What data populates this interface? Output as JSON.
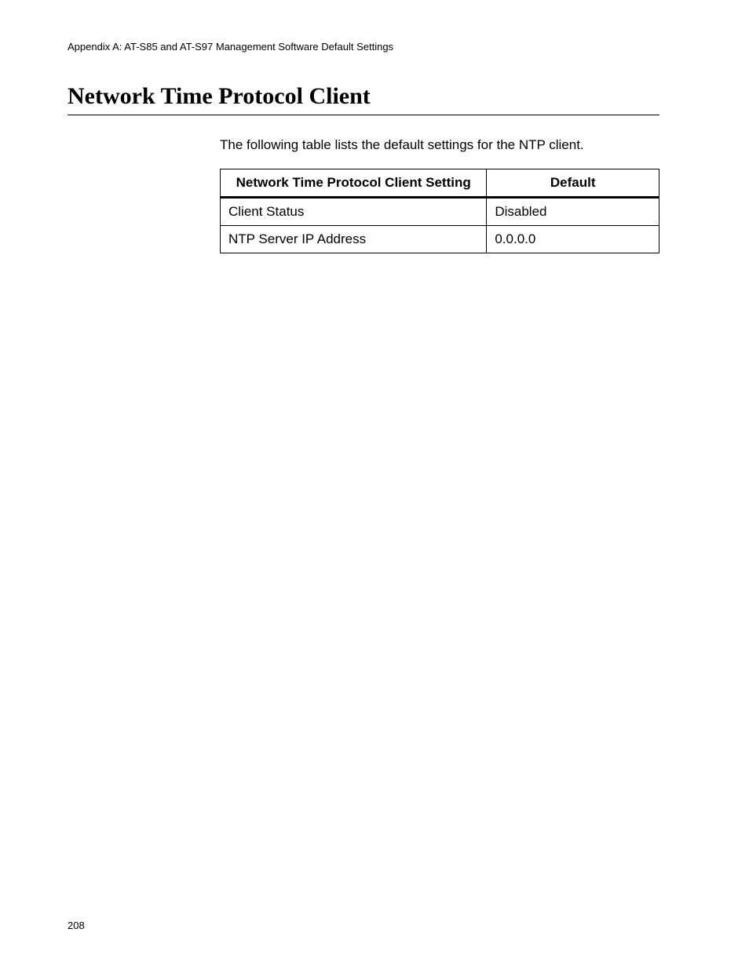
{
  "header": {
    "running": "Appendix A: AT-S85 and AT-S97 Management Software Default Settings"
  },
  "section": {
    "title": "Network Time Protocol Client",
    "intro": "The following table lists the default settings for the NTP client."
  },
  "table": {
    "headers": {
      "setting": "Network Time Protocol Client Setting",
      "default": "Default"
    },
    "rows": [
      {
        "setting": "Client Status",
        "default": "Disabled"
      },
      {
        "setting": "NTP Server IP Address",
        "default": "0.0.0.0"
      }
    ]
  },
  "footer": {
    "page_number": "208"
  }
}
